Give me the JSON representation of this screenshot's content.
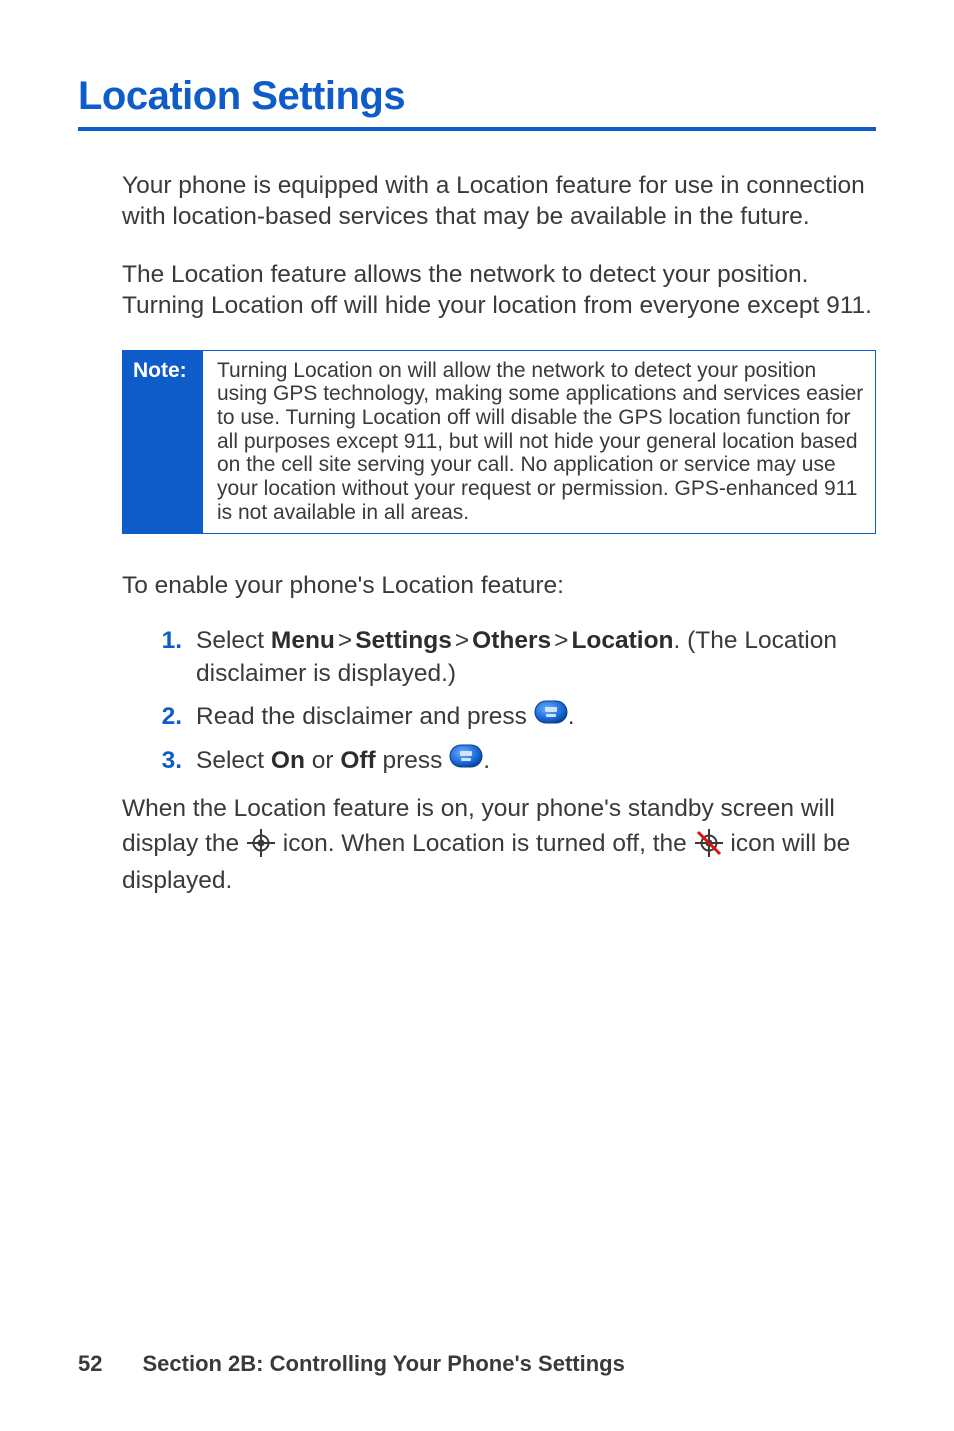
{
  "heading": "Location Settings",
  "paragraphs": {
    "p1": "Your phone is equipped with a Location feature for use in connection with location-based services that may be available in the future.",
    "p2": "The Location feature allows the network to detect your position. Turning Location off will hide your location from everyone except 911."
  },
  "note": {
    "label": "Note:",
    "body": "Turning Location on will allow the network to detect your position using GPS technology, making some applications and services easier to use. Turning Location off will disable the GPS location function for all purposes except 911, but will not hide your general location based on the cell site serving your call. No application or service may use your location without your request or permission. GPS-enhanced 911 is not available in all areas."
  },
  "procedure": {
    "lead": "To enable your phone's Location feature:",
    "steps": {
      "s1_part1": "Select ",
      "s1_menu": "Menu",
      "s1_settings": "Settings",
      "s1_others": "Others",
      "s1_location": "Location",
      "s1_part2": ". (The Location disclaimer is displayed.)",
      "s2_part1": "Read the disclaimer and press ",
      "s2_suffix": ".",
      "s3_part1": "Select ",
      "s3_on": "On",
      "s3_or": " or ",
      "s3_off": "Off",
      "s3_part2": " press ",
      "s3_suffix": "."
    }
  },
  "closing": {
    "c1": "When the Location feature is on, your phone's standby screen will display the ",
    "c2": " icon. When Location is turned off, the ",
    "c3": " icon will be displayed."
  },
  "footer": {
    "page_number": "52",
    "section_label": "Section 2B: Controlling Your Phone's Settings"
  },
  "colors": {
    "accent": "#0d5cc9",
    "text": "#3a3a3a"
  }
}
